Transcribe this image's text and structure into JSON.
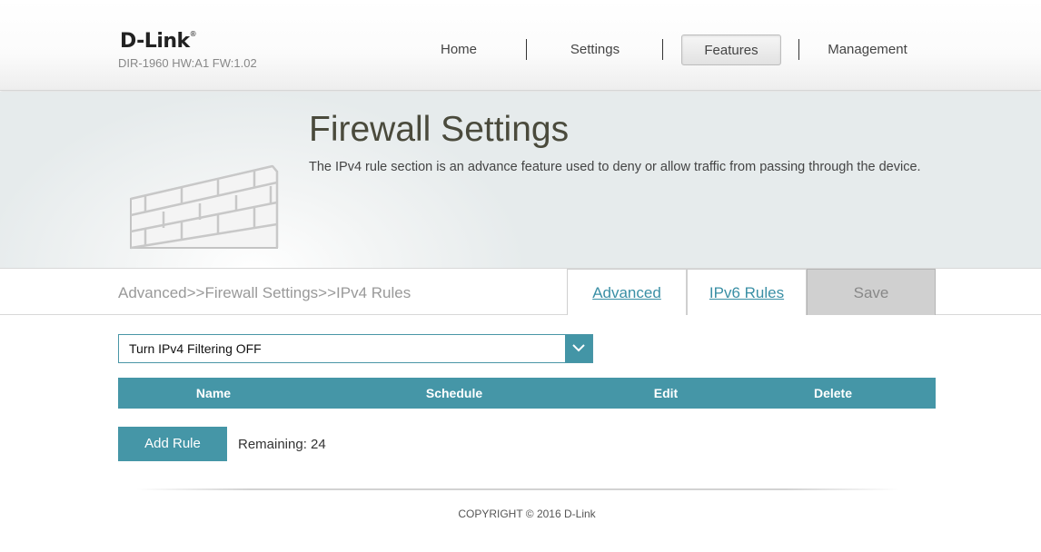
{
  "header": {
    "logo": "D-Link",
    "model": "DIR-1960 HW:A1 FW:1.02",
    "nav": {
      "home": "Home",
      "settings": "Settings",
      "features": "Features",
      "management": "Management"
    },
    "active_nav": "Features"
  },
  "banner": {
    "title": "Firewall Settings",
    "description": "The IPv4 rule section is an advance feature used to deny or allow traffic from passing through the device.",
    "icon": "brick-wall-icon"
  },
  "toolbar": {
    "breadcrumb": "Advanced>>Firewall Settings>>IPv4 Rules",
    "advanced_link": "Advanced",
    "ipv6_link": "IPv6 Rules",
    "save_label": "Save"
  },
  "filter": {
    "selected": "Turn IPv4 Filtering OFF"
  },
  "table": {
    "columns": [
      "Name",
      "Schedule",
      "Edit",
      "Delete"
    ]
  },
  "actions": {
    "add_rule": "Add Rule",
    "remaining_label": "Remaining:",
    "remaining_value": "24"
  },
  "footer": {
    "copyright": "COPYRIGHT © 2016 D-Link"
  },
  "colors": {
    "accent": "#4596a7",
    "link": "#3a8fa5",
    "save_disabled": "#d0d0d0"
  }
}
